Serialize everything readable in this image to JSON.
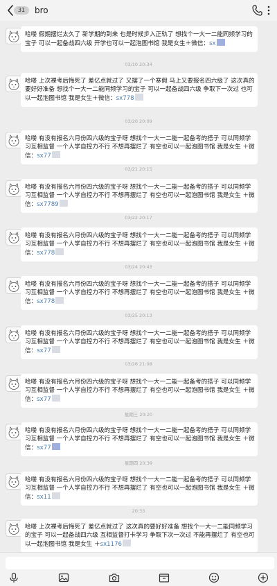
{
  "header": {
    "back_badge": "31",
    "title": "bro"
  },
  "messages": [
    {
      "text": "哈喽   假期摆烂太久了 新学期的到来 也是时候步入正轨了 想找个一大一二能同频学习的宝子 可以一起备战四六级 开学也可以一起泡图书馆 我是女生＋微信：",
      "link": "sx"
    },
    {
      "text": "哈喽   上次裸考后悔死了 差亿点就过了 又摆了一个寒假   马上又要报名四六级了 这次真的要好好准备 想找个一大一二能同频学习的宝子 可以一起备战四六级 争取下一次过  也可以一起泡图书馆 我是女生＋微信：",
      "link": "sx778"
    },
    {
      "text": "哈喽   有没有报名六月份四六级的宝子呀      想找个一大一二能一起备考的搭子 可以同频学习互相监督   一个人学自控力不行  不想再摆烂了  有空也可以一起泡图书馆  我是女生 ＋微信：",
      "link": "sx77"
    },
    {
      "text": "哈喽   有没有报名六月份四六级的宝子呀      想找个一大一二能一起备考的搭子 可以同频学习互相监督   一个人学自控力不行  不想再摆烂了  有空也可以一起泡图书馆  我是女生 ＋微信：",
      "link": "sx7789"
    },
    {
      "text": "哈喽   有没有报名六月份四六级的宝子呀      想找个一大一二能一起备考的搭子 可以同频学习互相监督   一个人学自控力不行  不想再摆烂了  有空也可以一起泡图书馆  我是女生 ＋微信：",
      "link": "sx778"
    },
    {
      "text": "哈喽   有没有报名六月份四六级的宝子呀      想找个一大一二能一起备考的搭子 可以同频学习互相监督   一个人学自控力不行  不想再摆烂了  有空也可以一起泡图书馆  我是女生 ＋微信：",
      "link": "sx778"
    },
    {
      "text": "哈喽   有没有报名六月份四六级的宝子呀      想找个一大一二能一起备考的搭子 可以同频学习互相监督   一个人学自控力不行  不想再摆烂了  有空也可以一起泡图书馆  我是女生 ＋微信：",
      "link": "sx77"
    },
    {
      "text": "哈喽   有没有报名六月份四六级的宝子呀      想找个一大一二能一起备考的搭子 可以同频学习互相监督   一个人学自控力不行  不想再摆烂了  有空也可以一起泡图书馆  我是女生 ＋微信：",
      "link": "sx77"
    },
    {
      "text": "哈喽   有没有报名六月份四六级的宝子呀      想找个一大一二能一起备考的搭子 可以同频学习互相监督   一个人学自控力不行  不想再摆烂了  有空也可以一起泡图书馆  我是女生 ＋微信：",
      "link": "sx77"
    },
    {
      "text": "哈喽   有没有报名六月份四六级的宝子呀      想找个一大一二能一起备考的搭子 可以同频学习互相监督   一个人学自控力不行  不想再摆烂了  有空也可以一起泡图书馆  我是女生 ＋微信：",
      "link": "sx11"
    },
    {
      "text": "哈喽   上次裸考后悔死了 差亿点就过了  这次真的要好好准备 想找个一大一二能同频学习的宝子 可以一起备战四六级 互相监督打卡学习 争取下次一次过  不能再摆烂了  有空也可以一起泡图书馆 我是女生 ＋",
      "link": "sx1176"
    }
  ],
  "timestamps": [
    "03/10 20:34",
    "03/20 20:09",
    "03/21 20:15",
    "03/22 20:17",
    "03/24 20:43",
    "03/25 20:13",
    "03/26 21:08",
    "星期三 20:20",
    "星期四 20:39",
    "20:33"
  ],
  "input": {
    "placeholder": ""
  },
  "icons": {
    "back": "chevron-left-icon",
    "phone": "phone-icon",
    "menu": "more-vertical-icon",
    "voice": "microphone-icon",
    "image": "image-icon",
    "camera": "camera-icon",
    "folder": "folder-icon",
    "emoji": "emoji-icon",
    "add": "add-icon"
  }
}
